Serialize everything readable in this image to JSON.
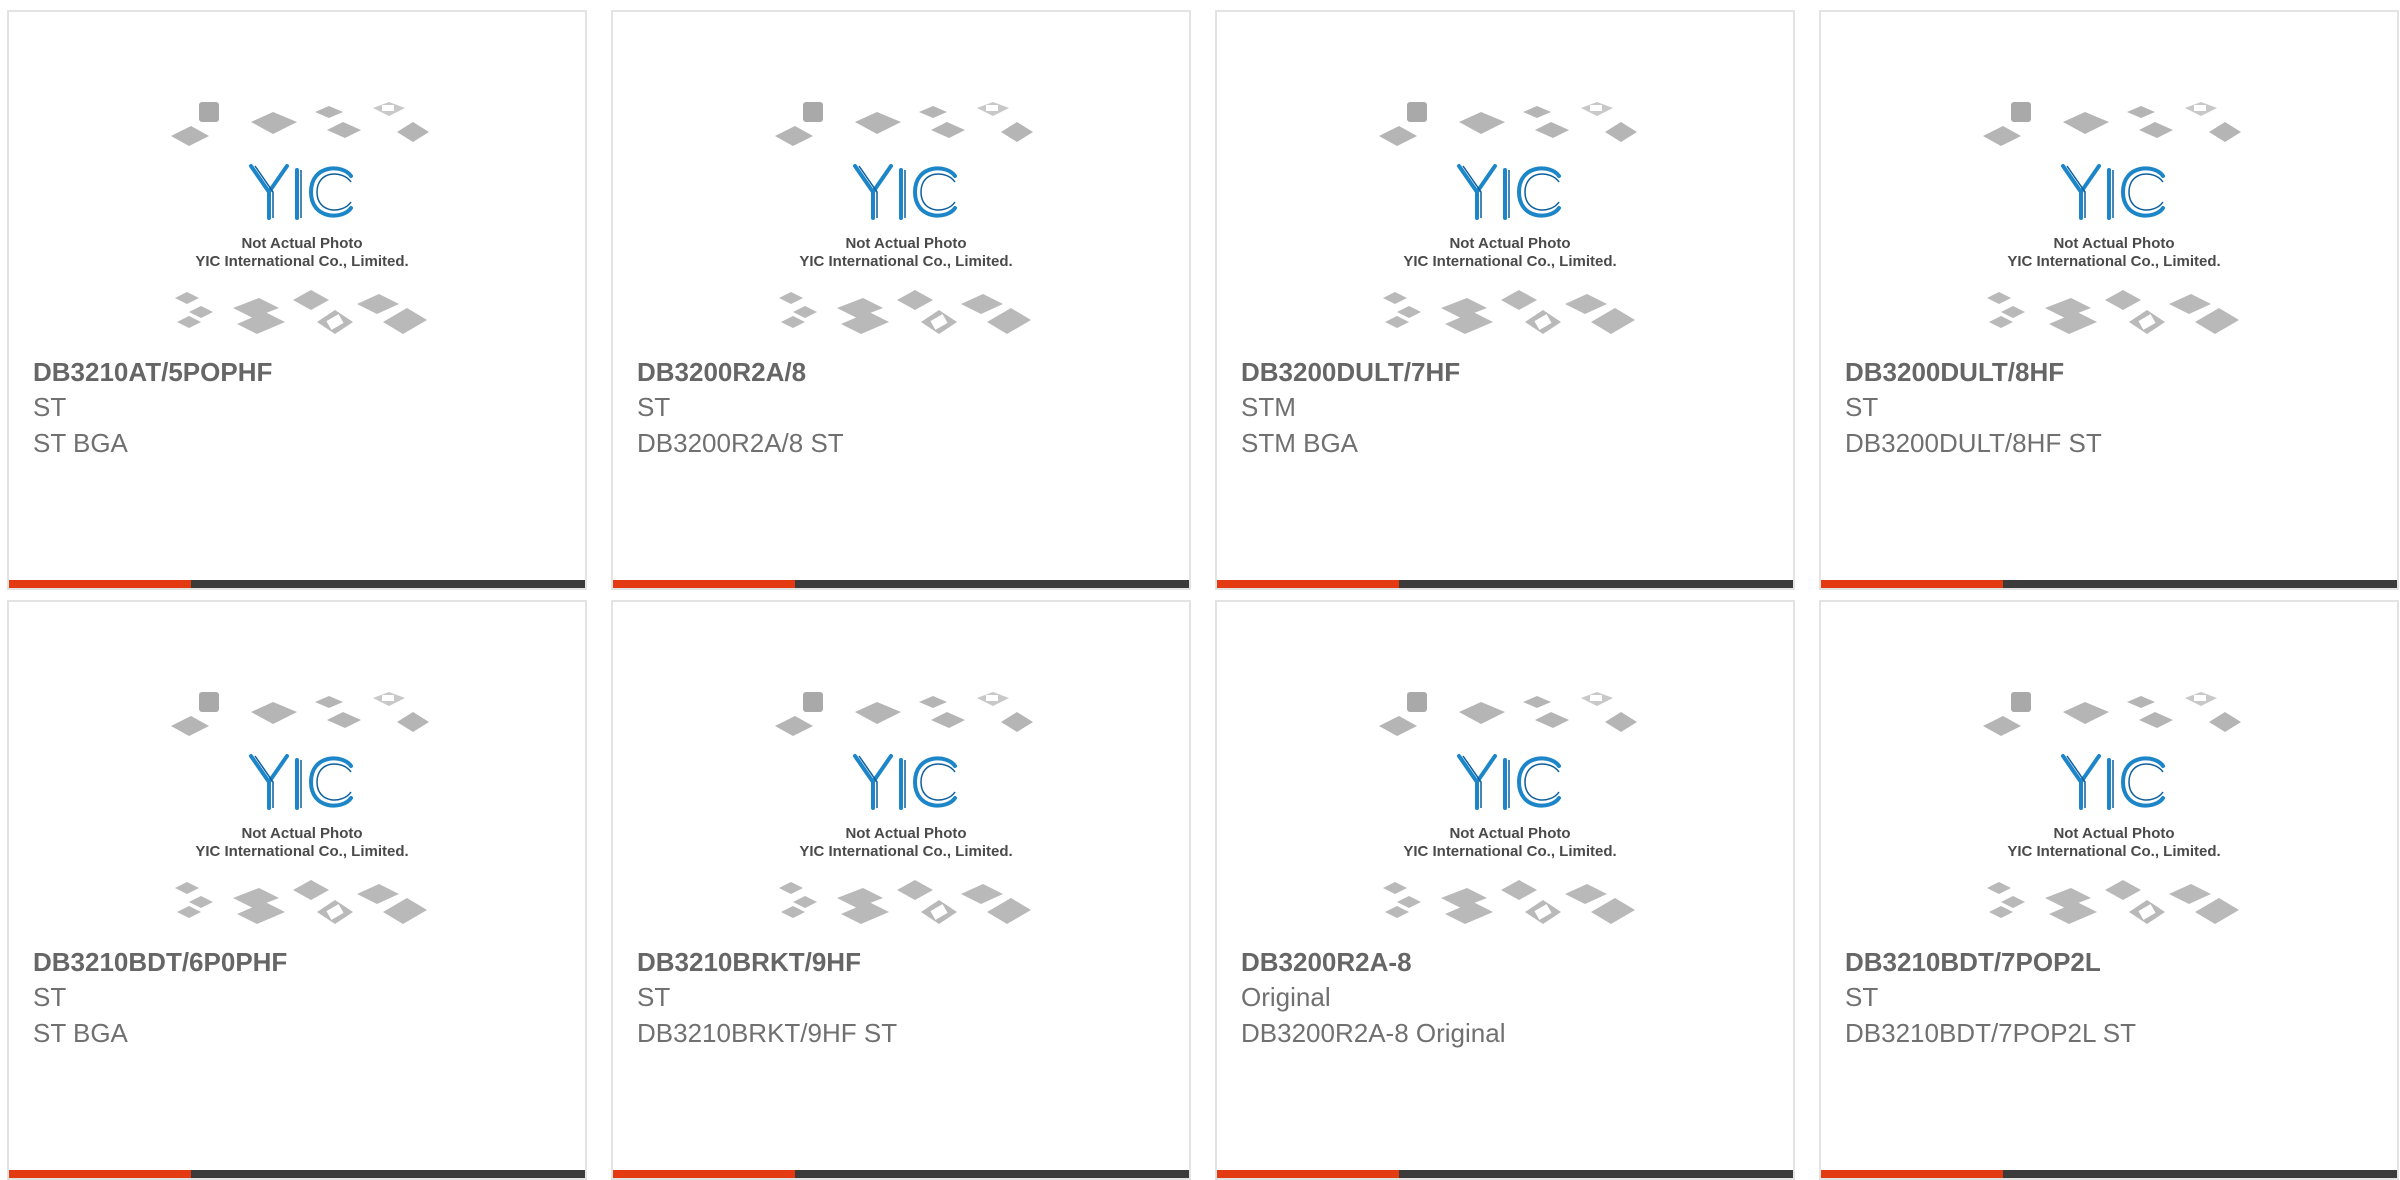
{
  "products": [
    {
      "part": "DB3210AT/5POPHF",
      "maker": "ST",
      "desc": "ST BGA"
    },
    {
      "part": "DB3200R2A/8",
      "maker": "ST",
      "desc": "DB3200R2A/8 ST"
    },
    {
      "part": "DB3200DULT/7HF",
      "maker": "STM",
      "desc": "STM BGA"
    },
    {
      "part": "DB3200DULT/8HF",
      "maker": "ST",
      "desc": "DB3200DULT/8HF ST"
    },
    {
      "part": "DB3210BDT/6P0PHF",
      "maker": "ST",
      "desc": "ST BGA"
    },
    {
      "part": "DB3210BRKT/9HF",
      "maker": "ST",
      "desc": "DB3210BRKT/9HF ST"
    },
    {
      "part": "DB3200R2A-8",
      "maker": "Original",
      "desc": "DB3200R2A-8 Original"
    },
    {
      "part": "DB3210BDT/7POP2L",
      "maker": "ST",
      "desc": "DB3210BDT/7POP2L ST"
    }
  ],
  "placeholder": {
    "logo_text": "YIC",
    "caption_line1": "Not Actual Photo",
    "caption_line2": "YIC International Co., Limited."
  },
  "colors": {
    "accent": "#e43a12",
    "bar": "#3b3b3b",
    "logo": "#1c86c8"
  }
}
